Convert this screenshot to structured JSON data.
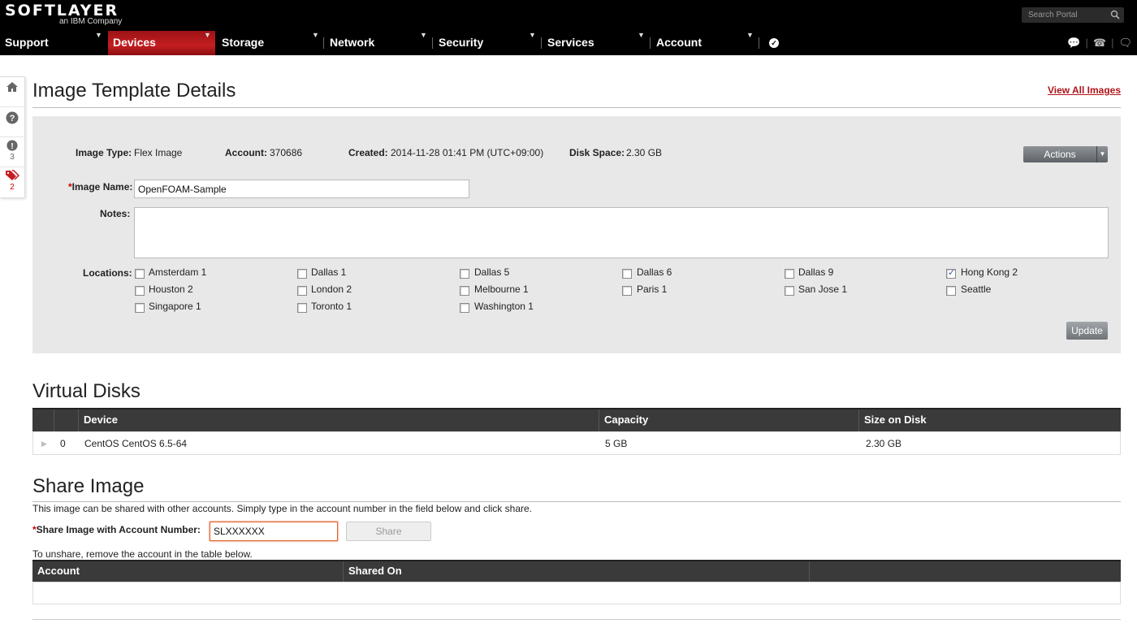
{
  "header": {
    "logo_main": "SOFTLAYER",
    "logo_sub": "an IBM Company",
    "search_placeholder": "Search Portal",
    "nav": [
      {
        "label": "Support"
      },
      {
        "label": "Devices",
        "active": true
      },
      {
        "label": "Storage"
      },
      {
        "label": "Network"
      },
      {
        "label": "Security"
      },
      {
        "label": "Services"
      },
      {
        "label": "Account"
      }
    ]
  },
  "rail": {
    "alerts_count": "3",
    "tickets_count": "2"
  },
  "page": {
    "title": "Image Template Details",
    "view_all": "View All Images"
  },
  "details": {
    "image_type_label": "Image Type:",
    "image_type": "Flex Image",
    "account_label": "Account:",
    "account": "370686",
    "created_label": "Created:",
    "created": "2014-11-28 01:41 PM (UTC+09:00)",
    "disk_space_label": "Disk Space:",
    "disk_space": "2.30 GB",
    "actions_label": "Actions",
    "image_name_label": "Image Name:",
    "image_name": "OpenFOAM-Sample",
    "notes_label": "Notes:",
    "notes": "",
    "locations_label": "Locations:",
    "locations": [
      {
        "name": "Amsterdam 1",
        "checked": false
      },
      {
        "name": "Dallas 1",
        "checked": false
      },
      {
        "name": "Dallas 5",
        "checked": false
      },
      {
        "name": "Dallas 6",
        "checked": false
      },
      {
        "name": "Dallas 9",
        "checked": false
      },
      {
        "name": "Hong Kong 2",
        "checked": true
      },
      {
        "name": "Houston 2",
        "checked": false
      },
      {
        "name": "London 2",
        "checked": false
      },
      {
        "name": "Melbourne 1",
        "checked": false
      },
      {
        "name": "Paris 1",
        "checked": false
      },
      {
        "name": "San Jose 1",
        "checked": false
      },
      {
        "name": "Seattle",
        "checked": false
      },
      {
        "name": "Singapore 1",
        "checked": false
      },
      {
        "name": "Toronto 1",
        "checked": false
      },
      {
        "name": "Washington 1",
        "checked": false
      }
    ],
    "update_label": "Update"
  },
  "virtual_disks": {
    "title": "Virtual Disks",
    "columns": [
      "Device",
      "Capacity",
      "Size on Disk"
    ],
    "rows": [
      {
        "index": "0",
        "device": "CentOS CentOS 6.5-64",
        "capacity": "5 GB",
        "size": "2.30 GB"
      }
    ]
  },
  "share": {
    "title": "Share Image",
    "intro": "This image can be shared with other accounts. Simply type in the account number in the field below and click share.",
    "field_label": "Share Image with Account Number:",
    "field_value": "SLXXXXXX",
    "share_label": "Share",
    "unshare_text": "To unshare, remove the account in the table below.",
    "columns": [
      "Account",
      "Shared On"
    ]
  },
  "colors": {
    "brand_red": "#c41d20",
    "link_red": "#b0141a"
  }
}
